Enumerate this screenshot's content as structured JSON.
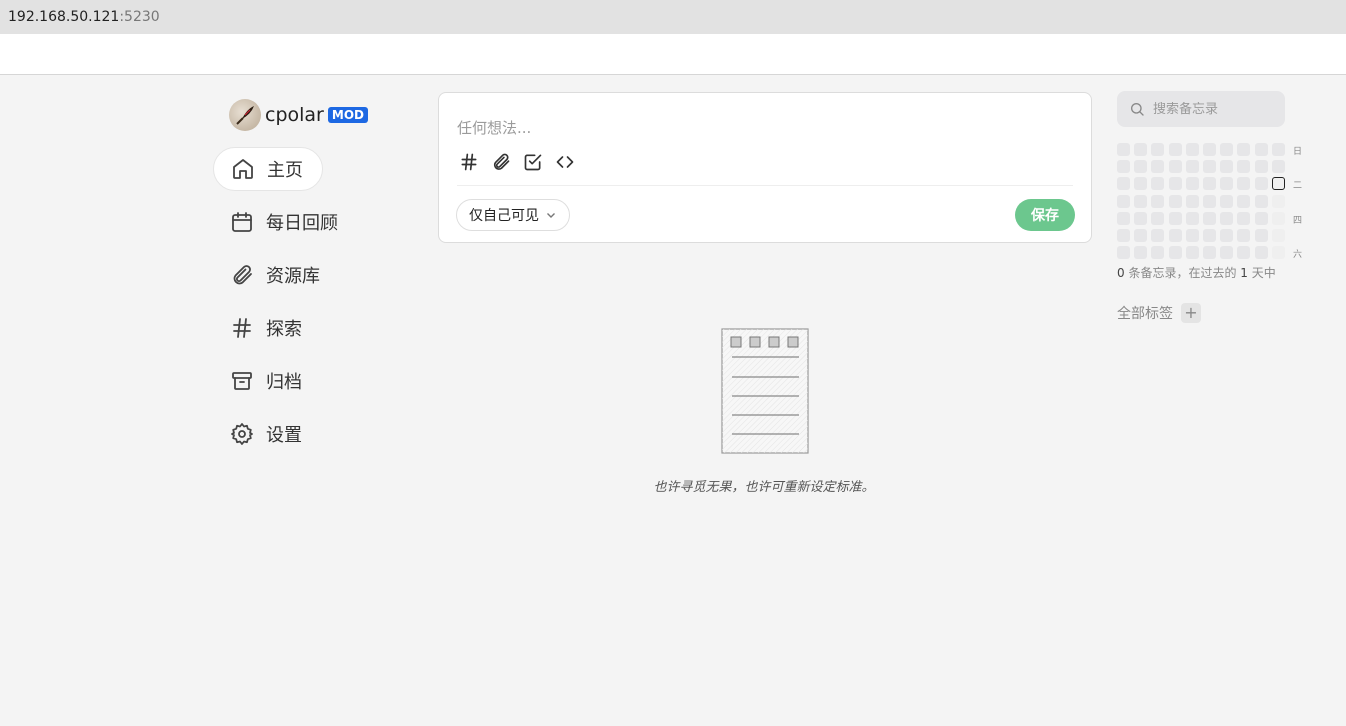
{
  "browser": {
    "host": "192.168.50.121",
    "port": ":5230"
  },
  "user": {
    "name": "cpolar",
    "badge": "MOD"
  },
  "nav": [
    {
      "label": "主页",
      "icon": "home-icon",
      "active": true
    },
    {
      "label": "每日回顾",
      "icon": "calendar-icon"
    },
    {
      "label": "资源库",
      "icon": "paperclip-icon"
    },
    {
      "label": "探索",
      "icon": "hash-icon"
    },
    {
      "label": "归档",
      "icon": "archive-icon"
    },
    {
      "label": "设置",
      "icon": "gear-icon"
    }
  ],
  "editor": {
    "placeholder": "任何想法...",
    "visibility": "仅自己可见",
    "save_label": "保存",
    "tools": [
      "hash-icon",
      "paperclip-icon",
      "checkbox-icon",
      "code-icon"
    ]
  },
  "empty_state": {
    "text": "也许寻觅无果，也许可重新设定标准。"
  },
  "search": {
    "placeholder": "搜索备忘录"
  },
  "heatmap": {
    "weekday_labels": [
      "日",
      "二",
      "四",
      "六"
    ]
  },
  "stats": {
    "count": "0",
    "prefix": " 条备忘录，在过去的 ",
    "days": "1",
    "suffix": " 天中"
  },
  "tags": {
    "label": "全部标签",
    "add": "+"
  },
  "colors": {
    "accent": "#6cc78e",
    "badge": "#1d68e3"
  }
}
